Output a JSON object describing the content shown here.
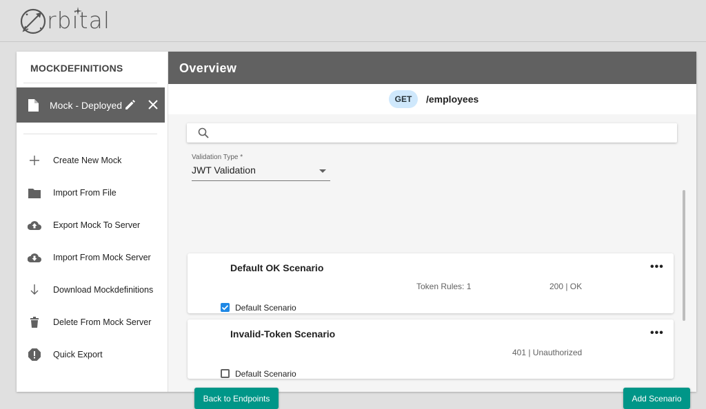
{
  "app": {
    "logo_text": "rbital",
    "logo_icon": "orbital-rocket-icon"
  },
  "sidebar": {
    "title": "MOCKDEFINITIONS",
    "active_mock": {
      "label": "Mock - Deployed",
      "icon": "document-icon",
      "edit_icon": "pencil-icon",
      "close_icon": "close-icon"
    },
    "items": [
      {
        "label": "Create New Mock",
        "icon": "plus-icon"
      },
      {
        "label": "Import From File",
        "icon": "folder-icon"
      },
      {
        "label": "Export Mock To Server",
        "icon": "cloud-upload-icon"
      },
      {
        "label": "Import From Mock Server",
        "icon": "cloud-download-icon"
      },
      {
        "label": "Download Mockdefinitions",
        "icon": "arrow-down-icon"
      },
      {
        "label": "Delete From Mock Server",
        "icon": "trash-icon"
      },
      {
        "label": "Quick Export",
        "icon": "alert-octagon-icon"
      }
    ]
  },
  "main": {
    "title": "Overview",
    "endpoint": {
      "method": "GET",
      "path": "/employees"
    },
    "search": {
      "placeholder": "",
      "value": "",
      "icon": "search-icon"
    },
    "validation": {
      "label": "Validation Type *",
      "value": "JWT Validation"
    },
    "scenarios": [
      {
        "name": "Default OK Scenario",
        "token_rules": "Token Rules: 1",
        "status": "200 | OK",
        "default_label": "Default Scenario",
        "is_default": true
      },
      {
        "name": "Invalid-Token Scenario",
        "token_rules": "",
        "status": "401 | Unauthorized",
        "default_label": "Default Scenario",
        "is_default": false
      }
    ],
    "menu_glyph": "•••",
    "buttons": {
      "back": "Back to Endpoints",
      "add": "Add Scenario"
    }
  },
  "colors": {
    "accent": "#009688",
    "header": "#616161",
    "badge": "#cfe8fc",
    "checkbox": "#1e88e5"
  }
}
